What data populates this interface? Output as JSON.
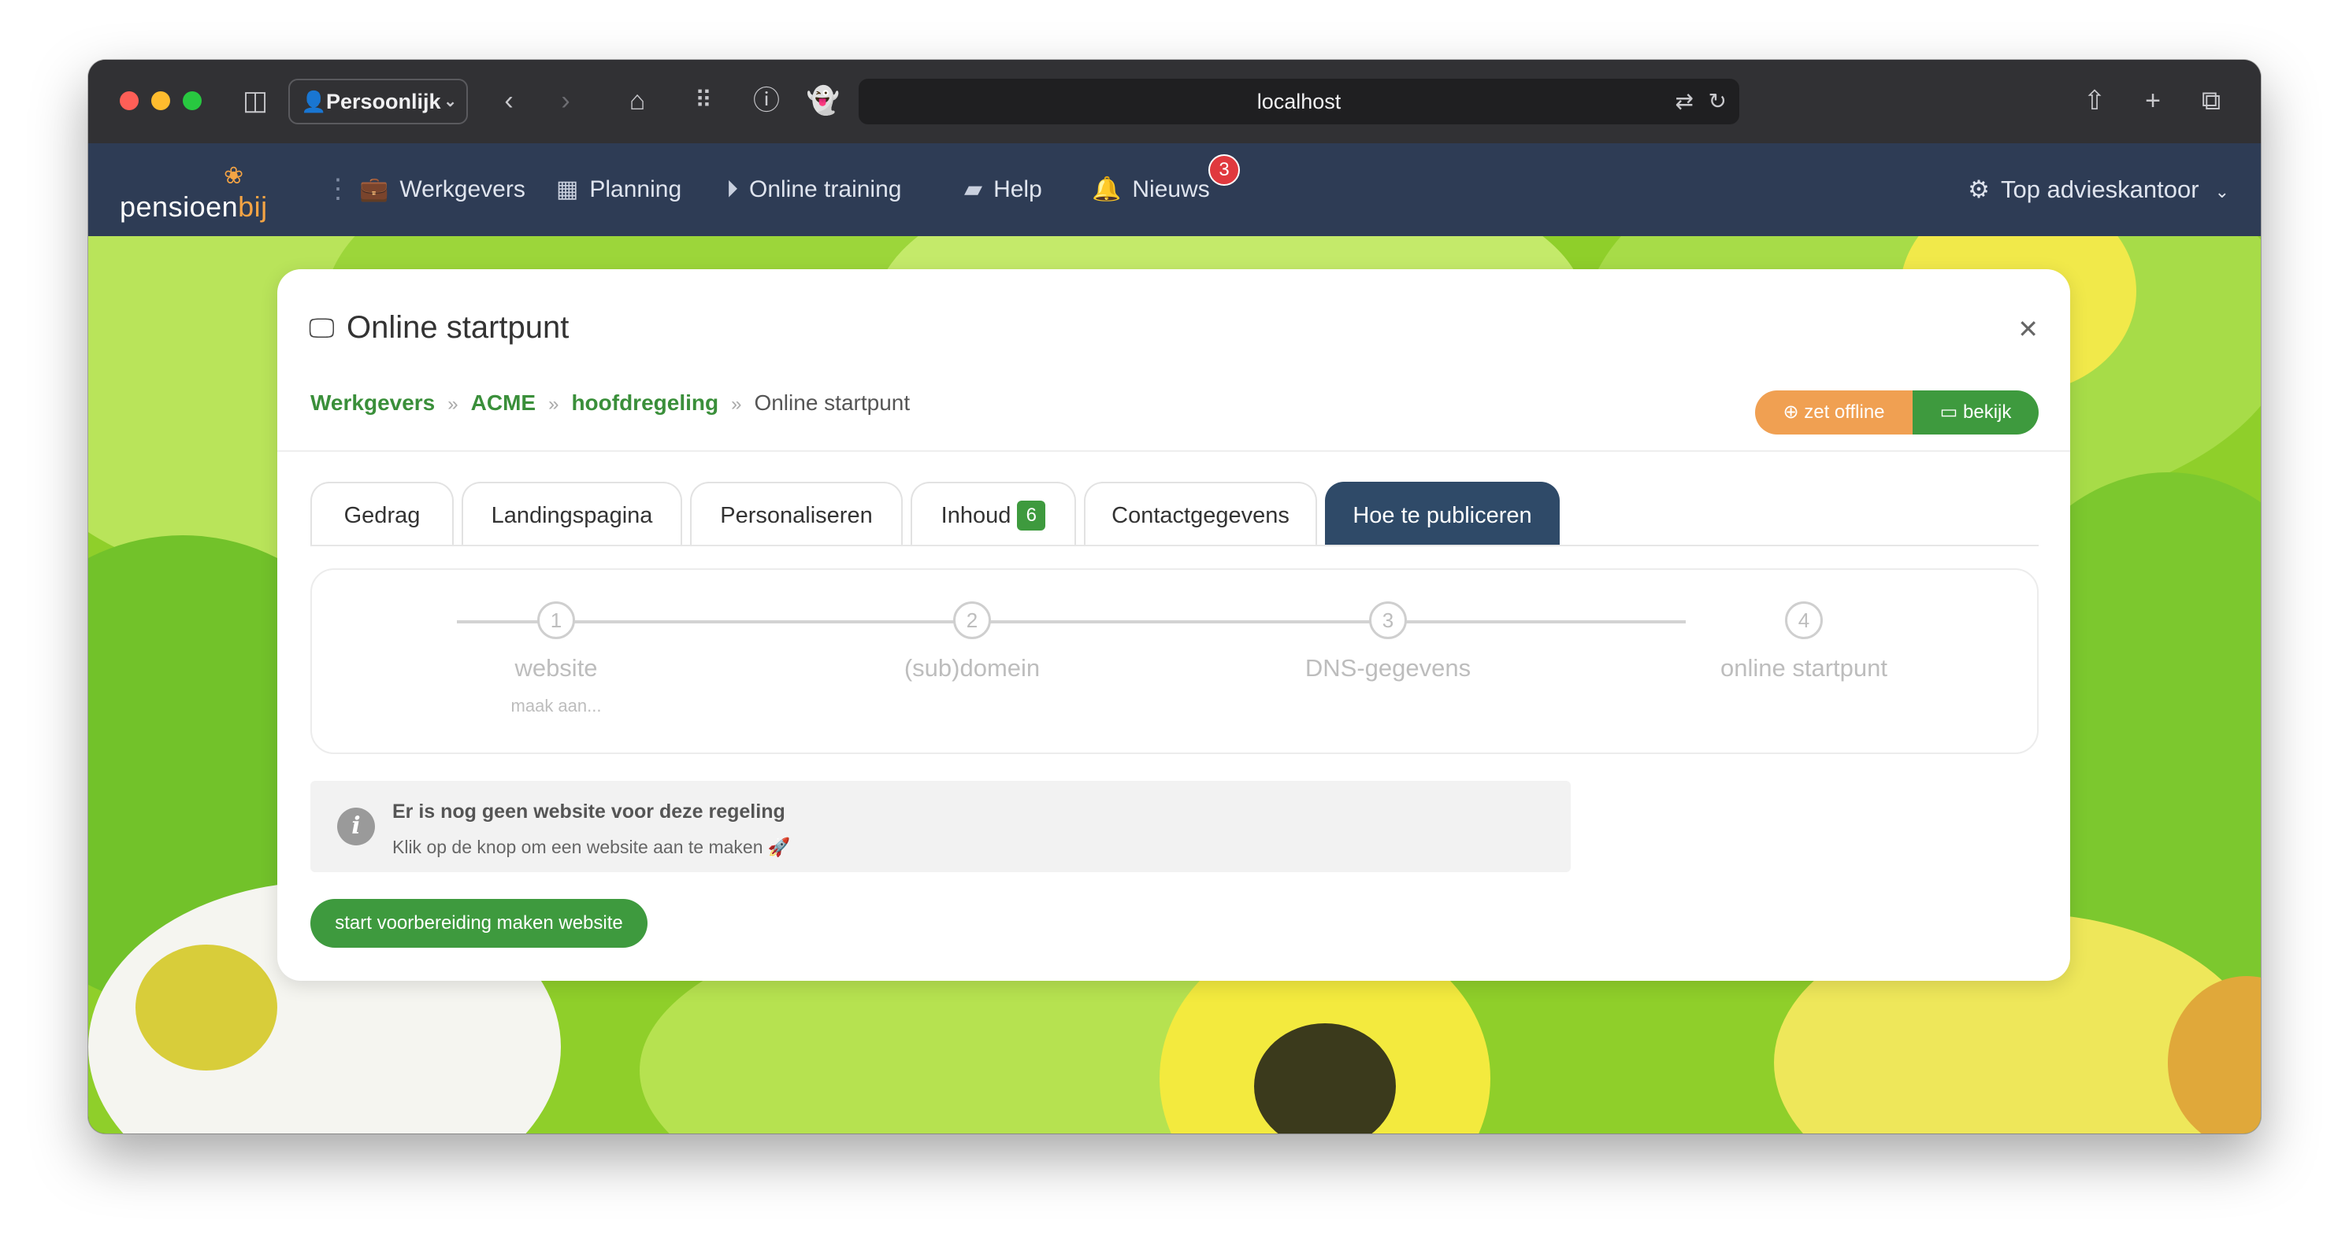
{
  "browser": {
    "profile_label": "Persoonlijk",
    "url": "localhost"
  },
  "app": {
    "logo": {
      "part1": "pensioen",
      "part2": "bij"
    },
    "nav": [
      {
        "label": "Werkgevers",
        "icon": "briefcase-icon"
      },
      {
        "label": "Planning",
        "icon": "calendar-icon"
      },
      {
        "label": "Online training",
        "icon": "play-circle-icon"
      },
      {
        "label": "Help",
        "icon": "book-icon"
      },
      {
        "label": "Nieuws",
        "icon": "bell-icon",
        "badge": "3"
      }
    ],
    "account_label": "Top advieskantoor"
  },
  "card": {
    "title": "Online startpunt",
    "breadcrumb": [
      "Werkgevers",
      "ACME",
      "hoofdregeling",
      "Online startpunt"
    ],
    "btn_offline": "zet offline",
    "btn_bekijk": "bekijk",
    "tabs": [
      {
        "label": "Gedrag"
      },
      {
        "label": "Landingspagina"
      },
      {
        "label": "Personaliseren"
      },
      {
        "label": "Inhoud",
        "badge": "6"
      },
      {
        "label": "Contactgegevens"
      },
      {
        "label": "Hoe te publiceren",
        "active": true
      }
    ],
    "steps": [
      {
        "num": "1",
        "label": "website",
        "sub": "maak aan..."
      },
      {
        "num": "2",
        "label": "(sub)domein"
      },
      {
        "num": "3",
        "label": "DNS-gegevens"
      },
      {
        "num": "4",
        "label": "online startpunt"
      }
    ],
    "info": {
      "title": "Er is nog geen website voor deze regeling",
      "text": "Klik op de knop om een website aan te maken 🚀"
    },
    "start_button": "start voorbereiding maken website"
  },
  "colors": {
    "navbar": "#2e3c55",
    "green": "#3e9a3e",
    "orange": "#f0a052",
    "active_tab": "#2f4a68"
  }
}
